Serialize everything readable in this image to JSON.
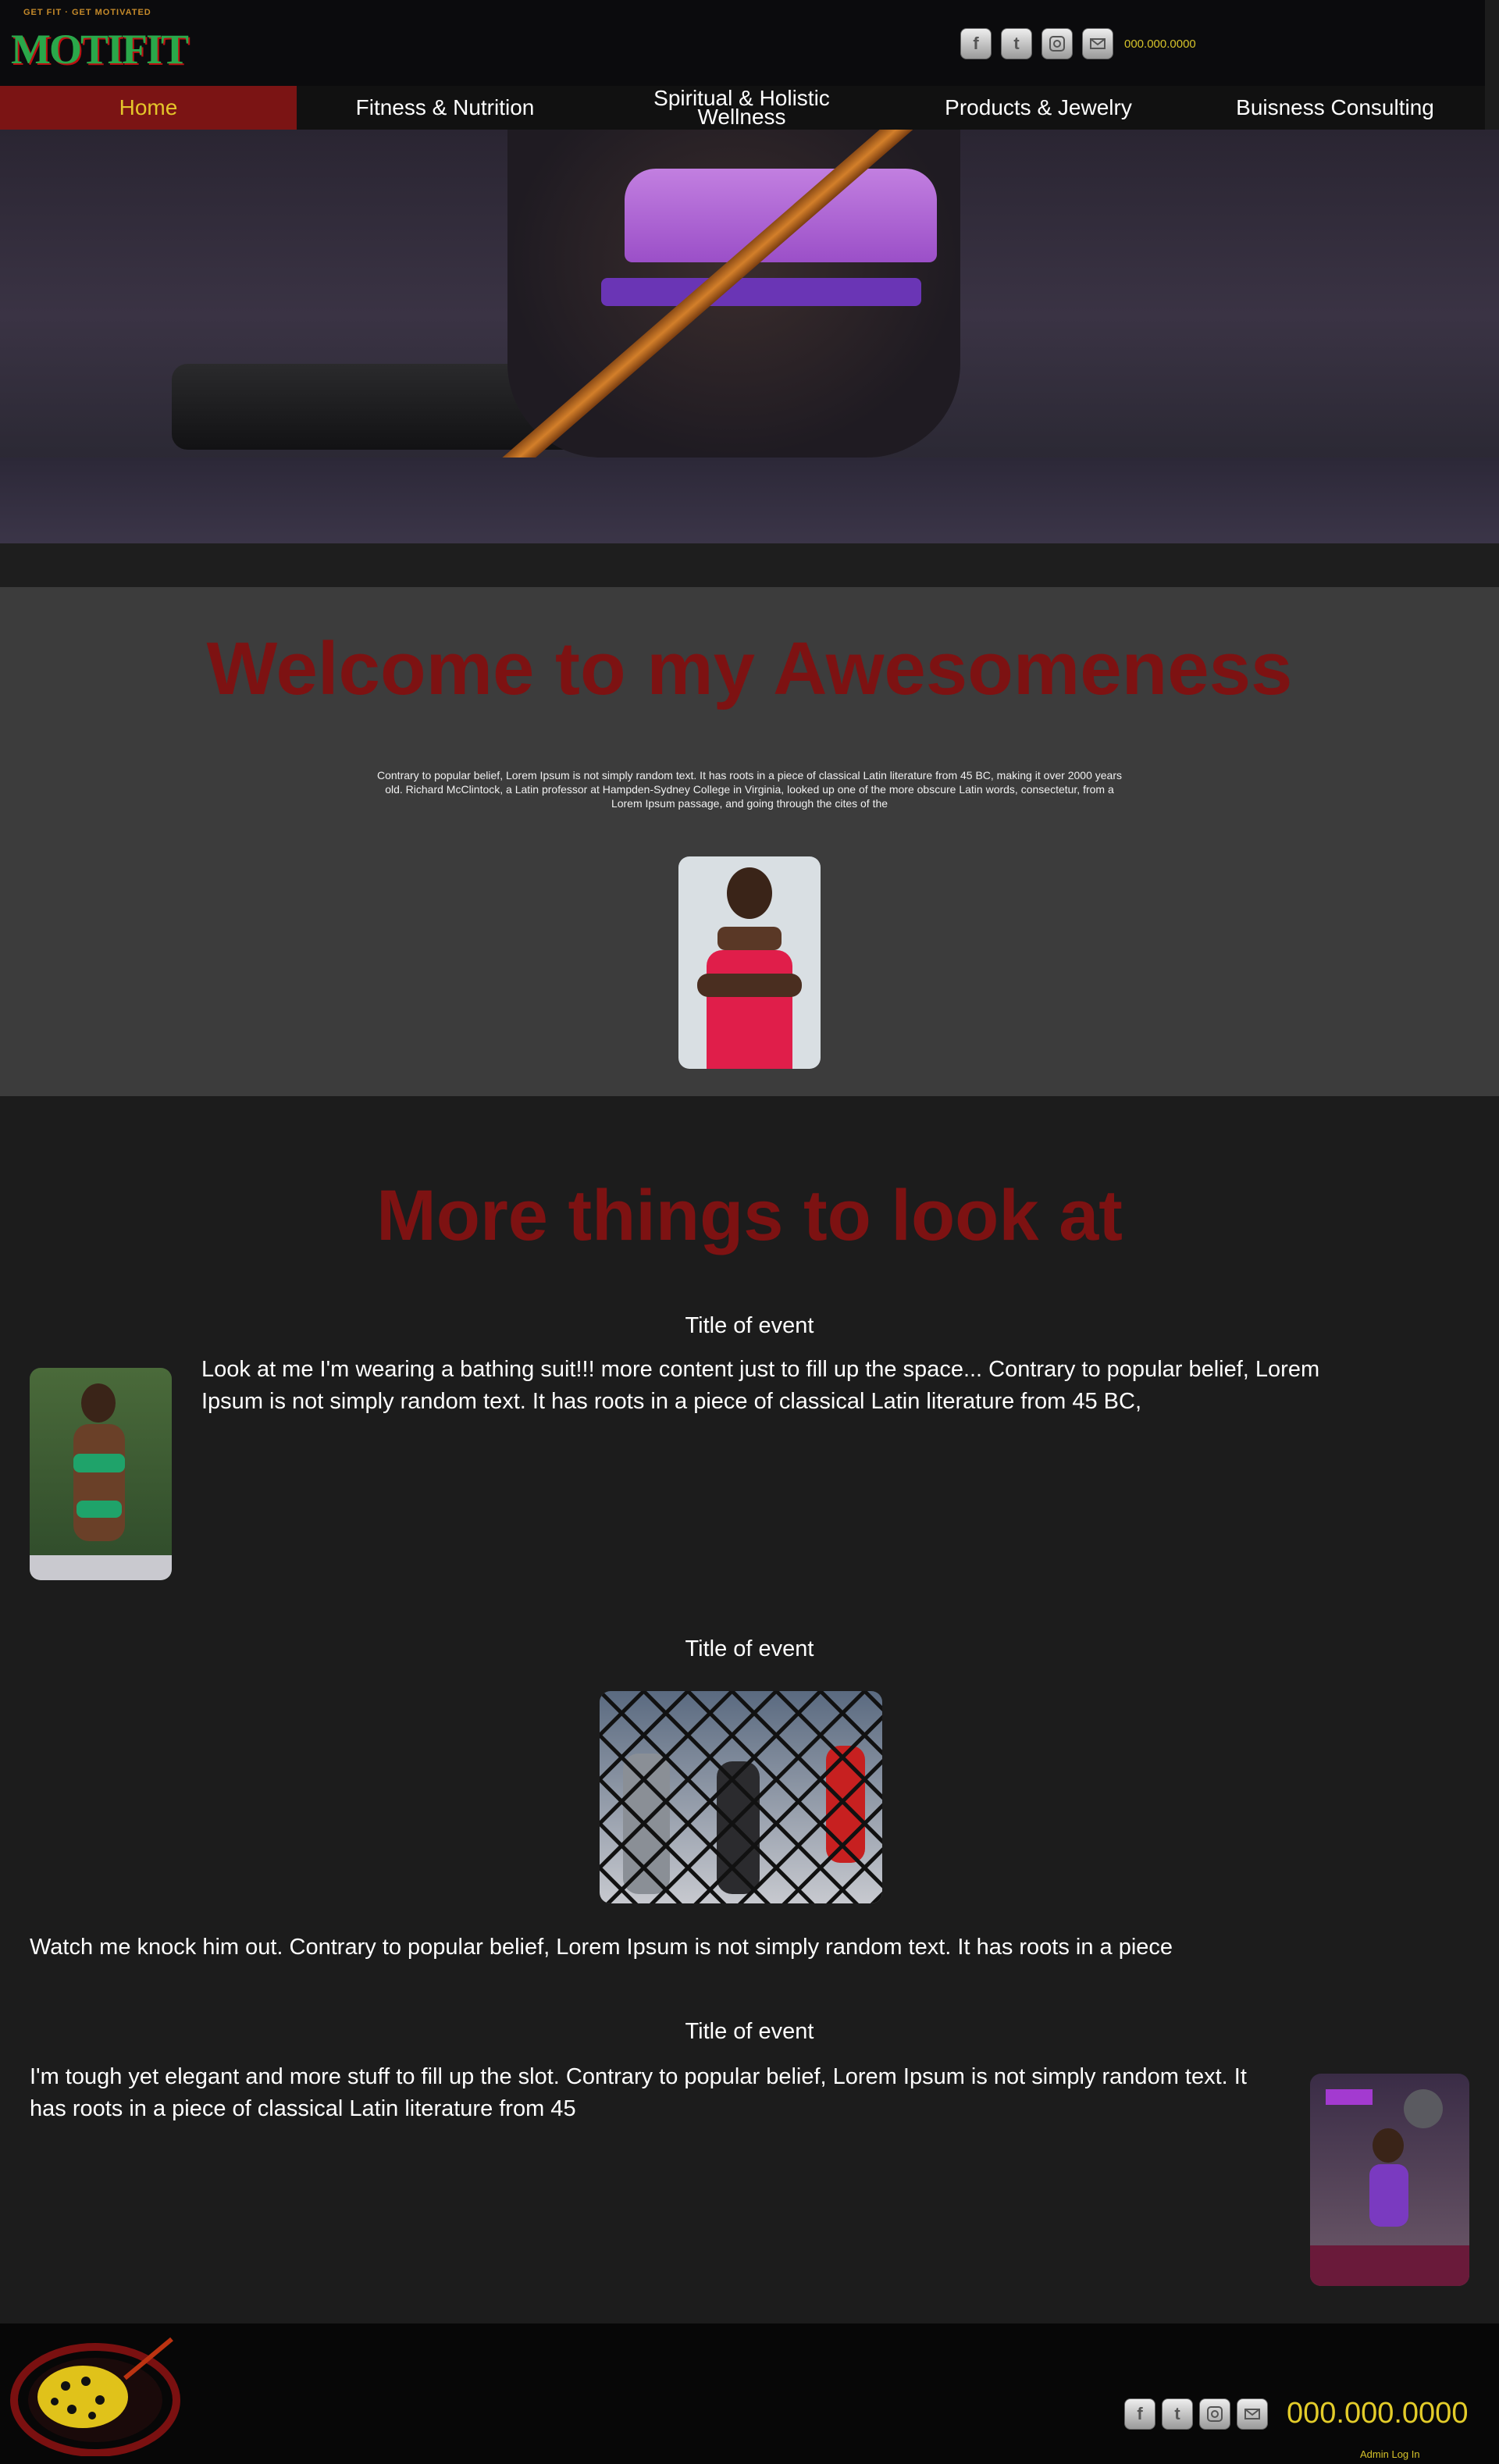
{
  "header": {
    "tagline": "GET FIT · GET MOTIVATED",
    "logo_text": "MOTIFIT",
    "phone": "000.000.0000",
    "social": [
      "facebook-icon",
      "twitter-icon",
      "instagram-icon",
      "mail-icon"
    ]
  },
  "nav": {
    "items": [
      {
        "label": "Home",
        "active": true
      },
      {
        "label": "Fitness & Nutrition",
        "active": false
      },
      {
        "label": "Spiritual & Holistic Wellness",
        "active": false
      },
      {
        "label": "Products & Jewelry",
        "active": false
      },
      {
        "label": "Buisness Consulting",
        "active": false
      }
    ]
  },
  "welcome": {
    "title": "Welcome to my Awesomeness",
    "text": "Contrary to popular belief, Lorem Ipsum is not simply random text. It has roots in a piece of classical Latin literature from 45 BC, making it over 2000 years old. Richard McClintock, a Latin professor at Hampden-Sydney College in Virginia, looked up one of the more obscure Latin words, consectetur, from a Lorem Ipsum passage, and going through the cites of the"
  },
  "more": {
    "title": "More things to look at",
    "events": [
      {
        "title": "Title of event",
        "text": "Look at me I'm wearing a bathing suit!!! more content just to fill up the space... Contrary to popular belief, Lorem Ipsum is not simply random text. It has roots in a piece of classical Latin literature from 45 BC,"
      },
      {
        "title": "Title of event",
        "text": "Watch me knock him out. Contrary to popular belief, Lorem Ipsum is not simply random text. It has roots in a piece"
      },
      {
        "title": "Title of event",
        "text": "I'm tough yet elegant and more stuff to fill up the slot. Contrary to popular belief, Lorem Ipsum is not simply random text. It has roots in a piece of classical Latin literature from 45"
      }
    ]
  },
  "footer": {
    "phone": "000.000.0000",
    "admin_label": "Admin Log In",
    "social": [
      "facebook-icon",
      "twitter-icon",
      "instagram-icon",
      "mail-icon"
    ]
  },
  "colors": {
    "accent_red": "#7d1212",
    "nav_active": "#7b1414",
    "phone_yellow": "#e3cc2a"
  }
}
